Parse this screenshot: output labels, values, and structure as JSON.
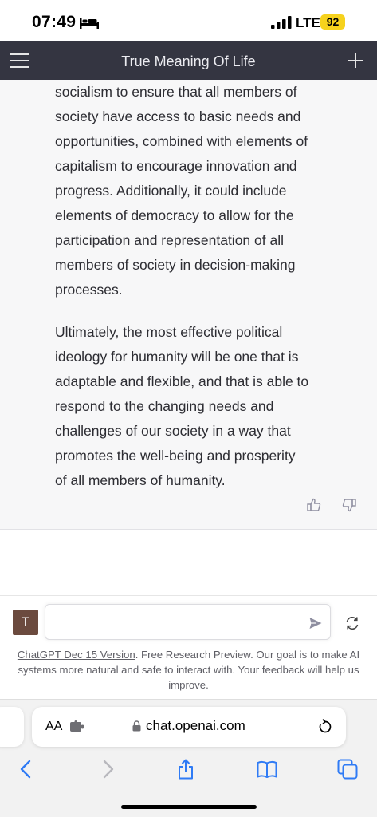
{
  "status_bar": {
    "time": "07:49",
    "network": "LTE",
    "battery": "92",
    "icons": [
      "bed-icon",
      "signal-icon"
    ]
  },
  "header": {
    "title": "True Meaning Of Life",
    "icons": [
      "menu-icon",
      "plus-icon"
    ]
  },
  "message": {
    "paragraphs": [
      "socialism to ensure that all members of society have access to basic needs and opportunities, combined with elements of capitalism to encourage innovation and progress. Additionally, it could include elements of democracy to allow for the participation and representation of all members of society in decision-making processes.",
      "Ultimately, the most effective political ideology for humanity will be one that is adaptable and flexible, and that is able to respond to the changing needs and challenges of our society in a way that promotes the well-being and prosperity of all members of humanity."
    ],
    "icons": [
      "thumbs-up-icon",
      "thumbs-down-icon"
    ]
  },
  "composer": {
    "avatar_letter": "T",
    "input_value": "",
    "placeholder": "",
    "icons": [
      "send-icon",
      "regenerate-icon"
    ],
    "footer_link": "ChatGPT Dec 15 Version",
    "footer_text": ". Free Research Preview. Our goal is to make AI systems more natural and safe to interact with. Your feedback will help us improve."
  },
  "browser": {
    "aa_label": "AA",
    "url": "chat.openai.com",
    "icons": [
      "extension-icon",
      "lock-icon",
      "reload-icon",
      "back-icon",
      "forward-icon",
      "share-icon",
      "bookmarks-icon",
      "tabs-icon"
    ]
  },
  "colors": {
    "header_bg": "#343541",
    "message_bg": "#f7f7f8",
    "battery": "#f6d21d",
    "safari_blue": "#2f7bf5",
    "avatar_bg": "#6b4a3e"
  }
}
